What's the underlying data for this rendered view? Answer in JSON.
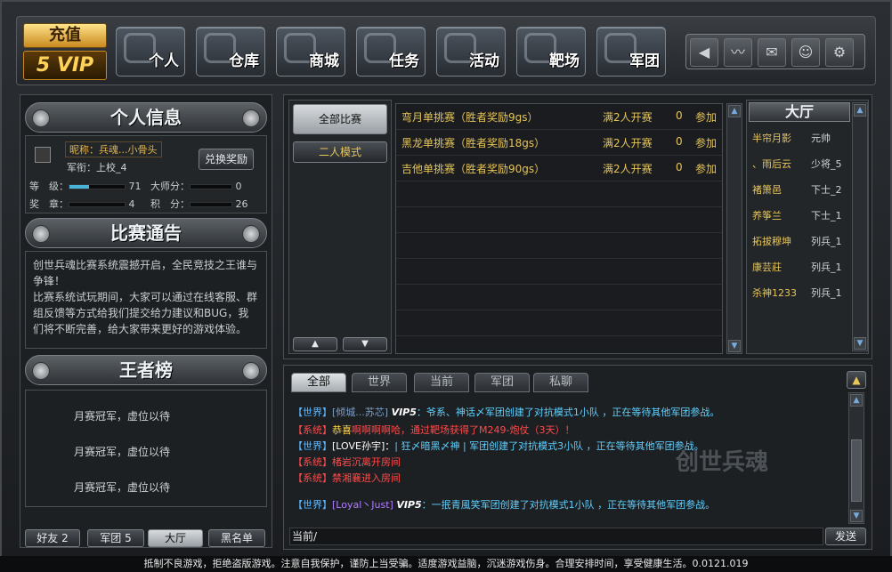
{
  "vip": {
    "charge": "充值",
    "level": "5",
    "vip": "VIP"
  },
  "nav": [
    {
      "label": "个人"
    },
    {
      "label": "仓库"
    },
    {
      "label": "商城"
    },
    {
      "label": "任务"
    },
    {
      "label": "活动"
    },
    {
      "label": "靶场"
    },
    {
      "label": "军团"
    }
  ],
  "rbtns": [
    "◀",
    "〰",
    "✉",
    "☺",
    "⚙"
  ],
  "profile": {
    "title": "个人信息",
    "nickname": "昵称：兵魂...小骨头",
    "rank": "军衔：上校_4",
    "exchange": "兑换奖励",
    "stats": [
      {
        "label": "等　级：",
        "value": "71",
        "fill": 0.35
      },
      {
        "label": "大师分：",
        "value": "0",
        "fill": 0
      },
      {
        "label": "奖　章：",
        "value": "4",
        "fill": 0
      },
      {
        "label": "积　分：",
        "value": "26",
        "fill": 0
      }
    ]
  },
  "notice": {
    "title": "比赛通告",
    "text1": "创世兵魂比赛系统震撼开启，全民竞技之王谁与争锋！",
    "text2": "比赛系统试玩期间，大家可以通过在线客服、群组反馈等方式给我们提交给力建议和BUG，我们将不断完善，给大家带来更好的游戏体验。"
  },
  "king": {
    "title": "王者榜",
    "rows": [
      "月赛冠军，虚位以待",
      "月赛冠军，虚位以待",
      "月赛冠军，虚位以待"
    ]
  },
  "bottom_tabs": [
    "好友 2",
    "军团 5",
    "大厅",
    "黑名单"
  ],
  "modes": [
    "全部比赛",
    "二人模式"
  ],
  "matches": [
    {
      "name": "弯月单挑赛（胜者奖励9gs）",
      "cond": "满2人开赛",
      "count": "0",
      "join": "参加"
    },
    {
      "name": "黑龙单挑赛（胜者奖励18gs）",
      "cond": "满2人开赛",
      "count": "0",
      "join": "参加"
    },
    {
      "name": "吉他单挑赛（胜者奖励90gs）",
      "cond": "满2人开赛",
      "count": "0",
      "join": "参加"
    }
  ],
  "hall": {
    "title": "大厅",
    "users": [
      {
        "name": "半帘月影",
        "rank": "元帅"
      },
      {
        "name": "、雨后云",
        "rank": "少将_5"
      },
      {
        "name": "褚箫邑",
        "rank": "下士_2"
      },
      {
        "name": "养筝兰",
        "rank": "下士_1"
      },
      {
        "name": "拓拔穆坤",
        "rank": "列兵_1"
      },
      {
        "name": "康芸莊",
        "rank": "列兵_1"
      },
      {
        "name": "杀神1233",
        "rank": "列兵_1"
      }
    ]
  },
  "chat_tabs": [
    "全部",
    "世界",
    "当前",
    "军团",
    "私聊"
  ],
  "chat": [
    {
      "tag": "【世界】",
      "name": "[倾城...苏芯]",
      "vip": "VIP5",
      "msg": "：爷系、神话〆军团创建了对抗模式1小队 ，正在等待其他军团参战。",
      "tc": "#5fb8ff",
      "nc": "#7d9fc6",
      "mc": "#5fd0ff"
    },
    {
      "tag": "【系统】",
      "name": "恭喜",
      "vip": "",
      "msg": "啊啊啊啊哈，通过靶场获得了M249-炮仗（3天）！",
      "tc": "#ff4a4a",
      "nc": "#ffd34a",
      "mc": "#ff4a4a"
    },
    {
      "tag": "【世界】",
      "name": "[LOVE孙宇]：",
      "vip": "",
      "msg": "| 狂〆暗黑〆神 | 军团创建了对抗模式3小队 ，正在等待其他军团参战。",
      "tc": "#5fb8ff",
      "nc": "#ffffff",
      "mc": "#5fd0ff"
    },
    {
      "tag": "【系统】",
      "name": "",
      "vip": "",
      "msg": "楮岩沉离开房间",
      "tc": "#ff4a4a",
      "nc": "#ff4a4a",
      "mc": "#ff4a4a"
    },
    {
      "tag": "【系统】",
      "name": "",
      "vip": "",
      "msg": "禁湘襄进入房间",
      "tc": "#ff4a4a",
      "nc": "#ff4a4a",
      "mc": "#ff4a4a"
    },
    {
      "tag": "【世界】",
      "name": "[Loyal丶Just]",
      "vip": "VIP5",
      "msg": "：一抿青風笑军团创建了对抗模式1小队 ，正在等待其他军团参战。",
      "tc": "#5fb8ff",
      "nc": "#b07dff",
      "mc": "#5fd0ff"
    }
  ],
  "watermark": "创世兵魂",
  "input": {
    "channel": "当前/",
    "send": "发送"
  },
  "footer": "抵制不良游戏，拒绝盗版游戏。注意自我保护，谨防上当受骗。适度游戏益脑，沉迷游戏伤身。合理安排时间，享受健康生活。0.0121.019"
}
